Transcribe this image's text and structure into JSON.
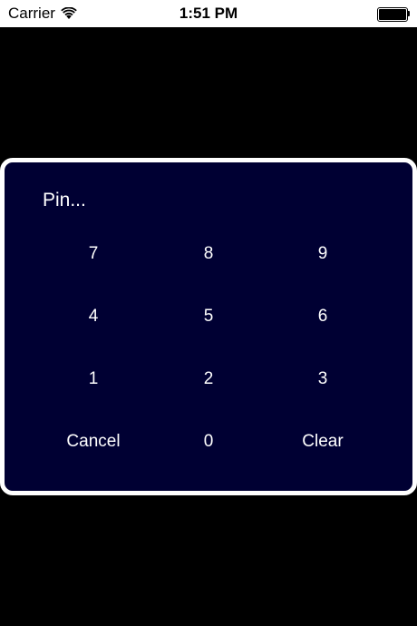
{
  "status_bar": {
    "carrier": "Carrier",
    "time": "1:51 PM",
    "wifi_icon": "wifi-icon",
    "battery_icon": "battery-icon"
  },
  "pin_dialog": {
    "display_text": "Pin...",
    "keys": [
      {
        "label": "7"
      },
      {
        "label": "8"
      },
      {
        "label": "9"
      },
      {
        "label": "4"
      },
      {
        "label": "5"
      },
      {
        "label": "6"
      },
      {
        "label": "1"
      },
      {
        "label": "2"
      },
      {
        "label": "3"
      },
      {
        "label": "Cancel"
      },
      {
        "label": "0"
      },
      {
        "label": "Clear"
      }
    ]
  },
  "colors": {
    "background": "#000000",
    "dialog_background": "#000033",
    "dialog_border": "#ffffff",
    "text": "#ffffff"
  }
}
